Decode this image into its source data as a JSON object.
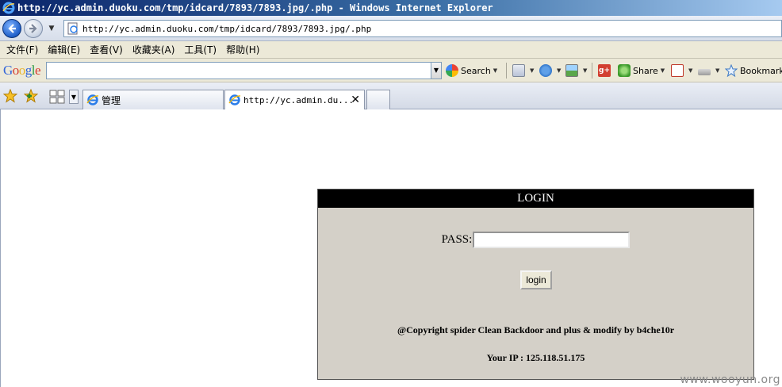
{
  "window": {
    "title": "http://yc.admin.duoku.com/tmp/idcard/7893/7893.jpg/.php - Windows Internet Explorer"
  },
  "address_bar": {
    "url": "http://yc.admin.duoku.com/tmp/idcard/7893/7893.jpg/.php"
  },
  "menu": {
    "items": [
      "文件(F)",
      "编辑(E)",
      "查看(V)",
      "收藏夹(A)",
      "工具(T)",
      "帮助(H)"
    ]
  },
  "google_toolbar": {
    "logo": "Google",
    "search_value": "",
    "search_label": "Search",
    "share_label": "Share",
    "bookmarks_label": "Bookmarks"
  },
  "tabs": [
    {
      "label": "管理",
      "active": false
    },
    {
      "label": "http://yc.admin.du...",
      "active": true
    }
  ],
  "page": {
    "header": "LOGIN",
    "pass_label": "PASS:",
    "pass_value": "",
    "login_button": "login",
    "copyright": "@Copyright spider Clean Backdoor and plus & modify by b4che10r",
    "your_ip": "Your IP : 125.118.51.175"
  },
  "watermark": "www.wooyun.org",
  "colors": {
    "title_bar_start": "#0a246a",
    "panel_bg": "#d4d0c8",
    "panel_header_bg": "#000000",
    "toolbar_bg": "#ece9d8"
  }
}
